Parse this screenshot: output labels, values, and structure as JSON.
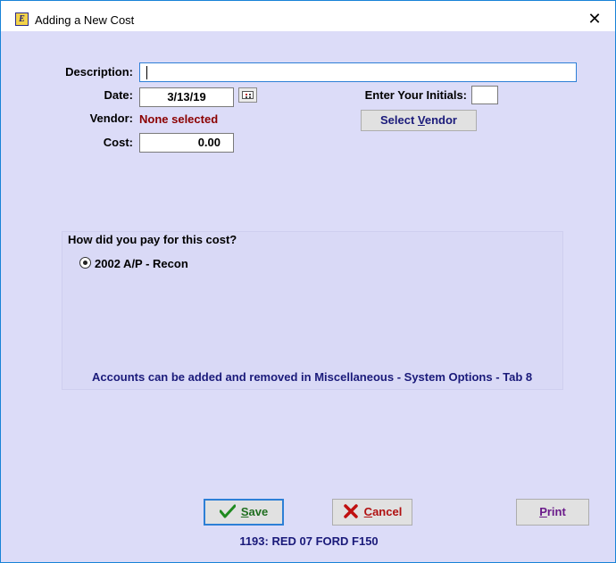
{
  "window": {
    "title": "Adding a New Cost",
    "app_icon_glyph": "E",
    "close_glyph": "✕"
  },
  "form": {
    "description_label": "Description:",
    "description_value": "",
    "date_label": "Date:",
    "date_value": "3/13/19",
    "vendor_label": "Vendor:",
    "vendor_value": "None selected",
    "cost_label": "Cost:",
    "cost_value": "0.00",
    "initials_label": "Enter Your Initials:",
    "initials_value": "",
    "select_vendor_label_pre": "Select ",
    "select_vendor_label_key": "V",
    "select_vendor_label_post": "endor"
  },
  "payment": {
    "question": "How did you pay for this cost?",
    "options": [
      {
        "label": "2002 A/P - Recon",
        "selected": true
      }
    ],
    "note": "Accounts can be added and removed in Miscellaneous - System Options - Tab 8"
  },
  "buttons": {
    "save_key": "S",
    "save_rest": "ave",
    "cancel_key": "C",
    "cancel_rest": "ancel",
    "print_key": "P",
    "print_rest": "rint"
  },
  "footer": "1193: RED 07 FORD F150",
  "colors": {
    "background": "#dcdcf8",
    "accent_blue": "#2d7fd6",
    "vendor_red": "#8b0000",
    "label_navy": "#1a1a7a"
  }
}
